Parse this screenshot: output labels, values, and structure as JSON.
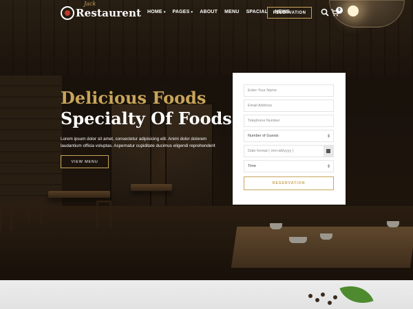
{
  "header": {
    "logo_text": "Restaurent",
    "logo_script": "Jack",
    "nav": [
      {
        "label": "HOME",
        "has_caret": true
      },
      {
        "label": "PAGES",
        "has_caret": true
      },
      {
        "label": "ABOUT",
        "has_caret": false
      },
      {
        "label": "MENU",
        "has_caret": false
      },
      {
        "label": "SPACIAL",
        "has_caret": false
      },
      {
        "label": "NEWS",
        "has_caret": false
      }
    ],
    "reservation_label": "RESERVATION",
    "cart_count": "0",
    "icons": [
      "search-icon",
      "cart-icon"
    ]
  },
  "hero": {
    "title_gold": "Delicious Foods",
    "title_white": "Specialty Of Foods",
    "description": "Lorem ipsum dolor sit amet, consectetur adipisicing elit. Animi dolor dolorem laudantium officia voluptas. Aspernatur cupiditate ducimus eligendi reprehenderit",
    "button_label": "VIEW MENU"
  },
  "form": {
    "name_placeholder": "Enter Your Name",
    "email_placeholder": "Email Address",
    "phone_placeholder": "Telephone Number",
    "guests_selected": "Number of Guests",
    "date_placeholder": "Date format ( mm-dd/yyyy )",
    "time_selected": "Time",
    "submit_label": "RESERVATION"
  },
  "colors": {
    "accent_gold": "#c9a55a",
    "form_background": "#ffffff",
    "text_white": "#ffffff"
  }
}
